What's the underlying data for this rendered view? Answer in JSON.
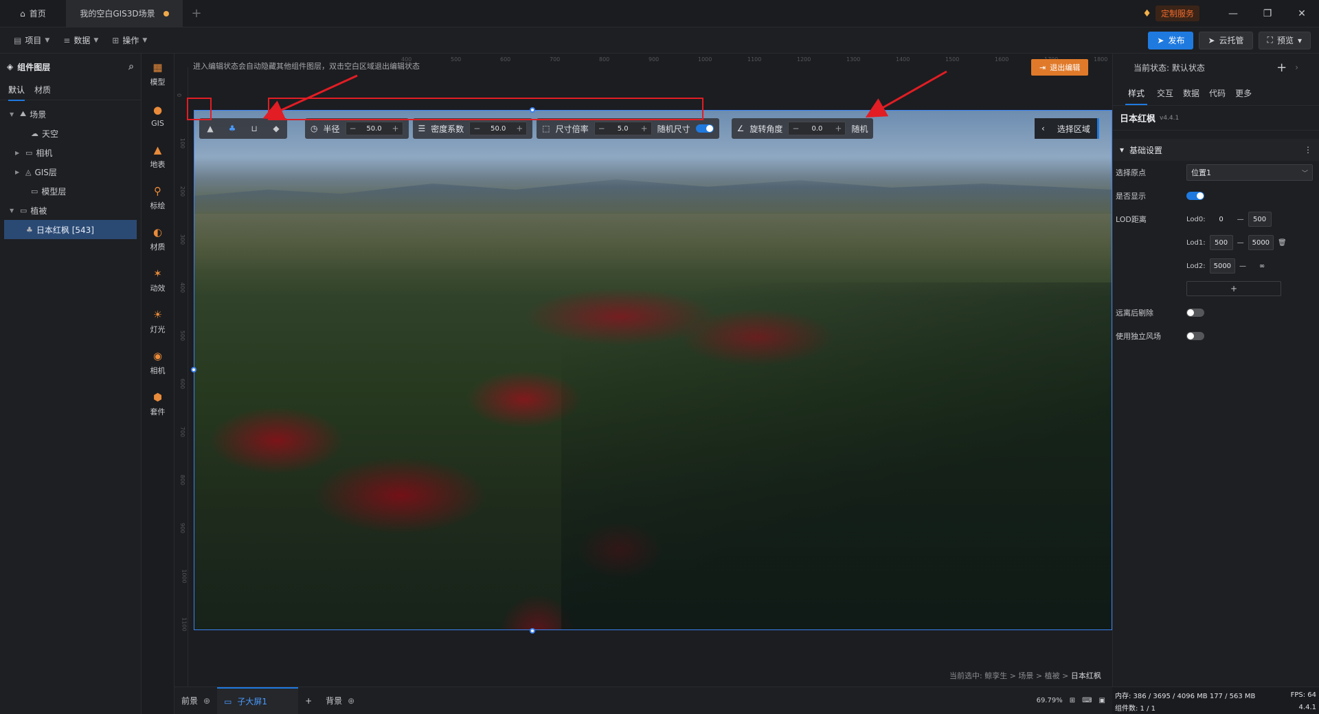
{
  "titlebar": {
    "home_tab": "首页",
    "doc_tab": "我的空白GIS3D场景",
    "add_tab": "+",
    "custom_service": "定制服务",
    "minimize": "—",
    "restore": "❐",
    "close": "✕"
  },
  "menubar": {
    "items": [
      {
        "icon": "file-icon",
        "label": "项目"
      },
      {
        "icon": "database-icon",
        "label": "数据"
      },
      {
        "icon": "grid-icon",
        "label": "操作"
      }
    ],
    "publish": "发布",
    "cloud": "云托管",
    "preview": "预览"
  },
  "layers": {
    "title": "组件图层",
    "tabs": [
      "默认",
      "材质"
    ],
    "tree": [
      {
        "label": "场景",
        "indent": 0,
        "expanded": true,
        "icon": "scene-icon"
      },
      {
        "label": "天空",
        "indent": 1,
        "icon": "sky-icon"
      },
      {
        "label": "相机",
        "indent": 1,
        "collapsed": true,
        "icon": "folder-icon"
      },
      {
        "label": "GIS层",
        "indent": 1,
        "collapsed": true,
        "icon": "gis-icon"
      },
      {
        "label": "模型层",
        "indent": 1,
        "icon": "folder-icon"
      },
      {
        "label": "植被",
        "indent": 0,
        "expanded": true,
        "icon": "folder-icon"
      },
      {
        "label": "日本红枫 [543]",
        "indent": 2,
        "selected": true,
        "icon": "tree-icon"
      }
    ]
  },
  "rail": [
    {
      "label": "模型",
      "icon": "model-icon"
    },
    {
      "label": "GIS",
      "icon": "globe-icon"
    },
    {
      "label": "地表",
      "icon": "terrain-icon"
    },
    {
      "label": "标绘",
      "icon": "pin-icon"
    },
    {
      "label": "材质",
      "icon": "material-icon"
    },
    {
      "label": "动效",
      "icon": "effect-icon"
    },
    {
      "label": "灯光",
      "icon": "light-icon"
    },
    {
      "label": "相机",
      "icon": "camera-icon"
    },
    {
      "label": "套件",
      "icon": "kit-icon"
    }
  ],
  "canvas": {
    "hint": "进入编辑状态会自动隐藏其他组件图层，双击空白区域退出编辑状态",
    "exit_edit": "退出编辑",
    "ruler_top": [
      "400",
      "500",
      "600",
      "700",
      "800",
      "900",
      "1000",
      "1100",
      "1200",
      "1300",
      "1400",
      "1500",
      "1600",
      "1700",
      "1800",
      "1900"
    ],
    "ruler_left": [
      "0",
      "100",
      "200",
      "300",
      "400",
      "500",
      "600",
      "700",
      "800",
      "900",
      "1000",
      "1100"
    ],
    "breadcrumb_prefix": "当前选中: 鲸孪生 > 场景 > 植被 > ",
    "breadcrumb_current": "日本红枫"
  },
  "brush": {
    "radius_label": "半径",
    "radius_value": "50.0",
    "density_label": "密度系数",
    "density_value": "50.0",
    "scale_label": "尺寸倍率",
    "scale_value": "5.0",
    "random_size_label": "随机尺寸",
    "rotation_label": "旋转角度",
    "rotation_value": "0.0",
    "random_label": "随机",
    "select_area": "选择区域"
  },
  "bottom": {
    "foreground": "前景",
    "child_screen": "子大屏1",
    "add": "+",
    "background": "背景",
    "zoom": "69.79%"
  },
  "props": {
    "state_label": "当前状态:",
    "state_value": "默认状态",
    "tabs": [
      "样式",
      "交互",
      "数据",
      "代码",
      "更多"
    ],
    "component_name": "日本红枫",
    "version": "v4.4.1",
    "section": "基础设置",
    "origin_label": "选择原点",
    "origin_value": "位置1",
    "visible_label": "是否显示",
    "lod_label": "LOD距离",
    "lod0_label": "Lod0:",
    "lod0_from": "0",
    "lod0_to": "500",
    "lod1_label": "Lod1:",
    "lod1_from": "500",
    "lod1_to": "5000",
    "lod2_label": "Lod2:",
    "lod2_from": "5000",
    "lod2_to": "∞",
    "add_lod": "+",
    "cull_label": "远离后剔除",
    "wind_label": "使用独立风场"
  },
  "status": {
    "memory": "内存: 386 / 3695 / 4096 MB 177 / 563 MB",
    "fps": "FPS: 64",
    "count": "组件数: 1 / 1",
    "version": "4.4.1"
  },
  "colors": {
    "accent": "#1f7ae0",
    "orange": "#e07a2a",
    "annotation": "#e21d24"
  }
}
